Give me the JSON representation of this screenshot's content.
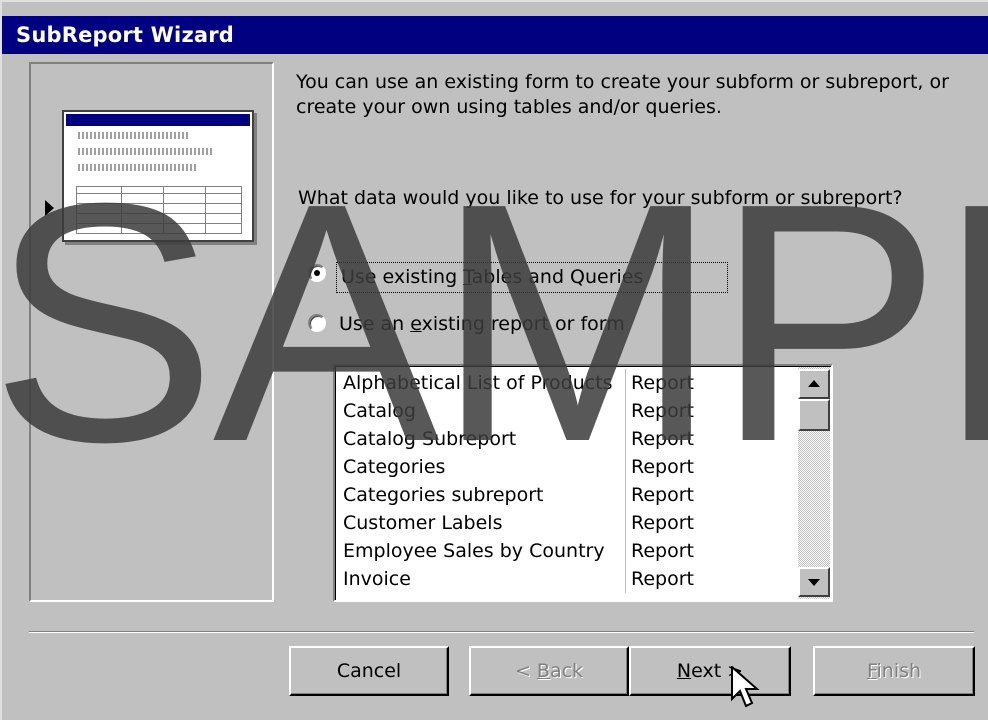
{
  "window": {
    "title": "SubReport Wizard"
  },
  "instructions": {
    "intro": "You can use an existing form to create your subform or subreport, or create your own using tables and/or queries.",
    "question": "What data would you like to use for your subform or subreport?"
  },
  "options": [
    {
      "pre": "Use existing ",
      "accel": "T",
      "post": "ables and Queries",
      "selected": true
    },
    {
      "pre": "Use an ",
      "accel": "e",
      "post": "xisting report or form",
      "selected": false
    }
  ],
  "list": {
    "rows": [
      {
        "name": "Alphabetical List of Products",
        "type": "Report"
      },
      {
        "name": "Catalog",
        "type": "Report"
      },
      {
        "name": "Catalog Subreport",
        "type": "Report"
      },
      {
        "name": "Categories",
        "type": "Report"
      },
      {
        "name": "Categories subreport",
        "type": "Report"
      },
      {
        "name": "Customer Labels",
        "type": "Report"
      },
      {
        "name": "Employee Sales by Country",
        "type": "Report"
      },
      {
        "name": "Invoice",
        "type": "Report"
      }
    ]
  },
  "buttons": {
    "cancel": "Cancel",
    "back": {
      "pre": "< ",
      "accel": "B",
      "post": "ack"
    },
    "next": {
      "pre": "",
      "accel": "N",
      "post": "ext >"
    },
    "finish": {
      "pre": "",
      "accel": "F",
      "post": "inish"
    }
  },
  "watermark": "SAMPL"
}
